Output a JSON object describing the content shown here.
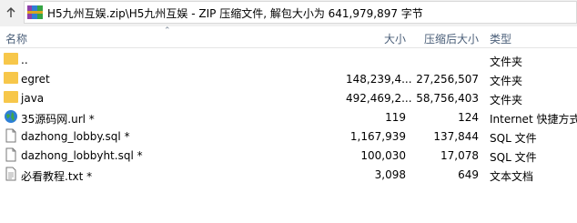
{
  "address": {
    "path": "H5九州互娱.zip\\H5九州互娱 - ZIP 压缩文件, 解包大小为 641,979,897 字节"
  },
  "columns": {
    "name": "名称",
    "size": "大小",
    "packed": "压缩后大小",
    "type": "类型"
  },
  "rows": [
    {
      "icon": "folder-up-icon",
      "name": "..",
      "size": "",
      "packed": "",
      "type": "文件夹"
    },
    {
      "icon": "folder-icon",
      "name": "egret",
      "size": "148,239,4...",
      "packed": "27,256,507",
      "type": "文件夹"
    },
    {
      "icon": "folder-icon",
      "name": "java",
      "size": "492,469,2...",
      "packed": "58,756,403",
      "type": "文件夹"
    },
    {
      "icon": "globe-icon",
      "name": "35源码网.url *",
      "size": "119",
      "packed": "124",
      "type": "Internet 快捷方式"
    },
    {
      "icon": "document-icon",
      "name": "dazhong_lobby.sql *",
      "size": "1,167,939",
      "packed": "137,844",
      "type": "SQL 文件"
    },
    {
      "icon": "document-icon",
      "name": "dazhong_lobbyht.sql *",
      "size": "100,030",
      "packed": "17,078",
      "type": "SQL 文件"
    },
    {
      "icon": "text-file-icon",
      "name": "必看教程.txt *",
      "size": "3,098",
      "packed": "649",
      "type": "文本文档"
    }
  ]
}
